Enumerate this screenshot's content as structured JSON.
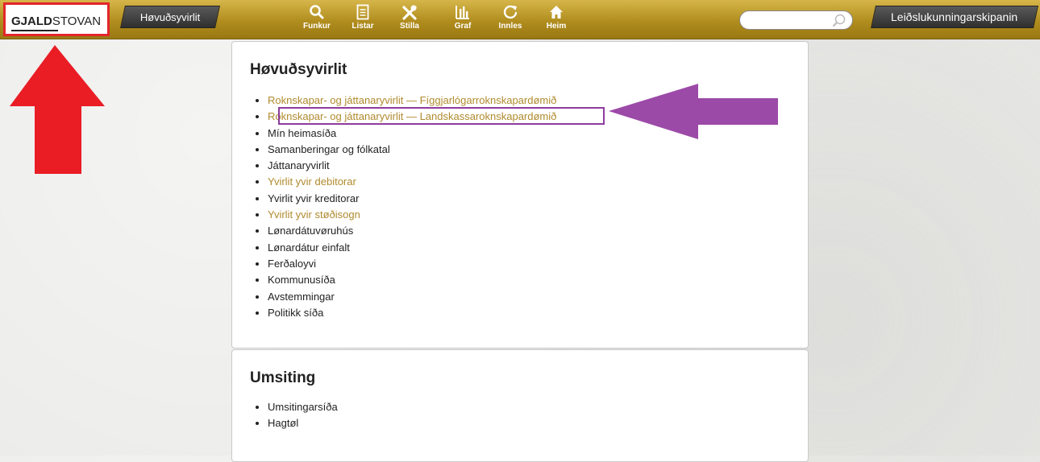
{
  "brand": {
    "bold": "GJALD",
    "light": "STOVAN"
  },
  "topbar": {
    "home_label": "Høvuðsyvirlit",
    "installation_label": "Leiðslukunningarskipanin",
    "nav": [
      {
        "label": "Funkur",
        "icon": "search-icon"
      },
      {
        "label": "Listar",
        "icon": "list-icon"
      },
      {
        "label": "Stilla",
        "icon": "tools-icon"
      },
      {
        "label": "Graf",
        "icon": "chart-icon"
      },
      {
        "label": "Innles",
        "icon": "refresh-icon"
      },
      {
        "label": "Heim",
        "icon": "home-icon"
      }
    ],
    "search": {
      "value": "",
      "placeholder": ""
    }
  },
  "overview": {
    "title": "Høvuðsyvirlit",
    "items": [
      {
        "label": "Roknskapar- og játtanaryvirlit — Fíggjarlógarroknskapardømið",
        "link": true
      },
      {
        "label": "Roknskapar- og játtanaryvirlit — Landskassaroknskapardømið",
        "link": true
      },
      {
        "label": "Mín heimasíða",
        "link": false
      },
      {
        "label": "Samanberingar og fólkatal",
        "link": false
      },
      {
        "label": "Játtanaryvirlit",
        "link": false
      },
      {
        "label": "Yvirlit yvir debitorar",
        "link": true
      },
      {
        "label": "Yvirlit yvir kreditorar",
        "link": false
      },
      {
        "label": "Yvirlit yvir støðisogn",
        "link": true
      },
      {
        "label": "Lønardátuvøruhús",
        "link": false
      },
      {
        "label": "Lønardátur einfalt",
        "link": false
      },
      {
        "label": "Ferðaloyvi",
        "link": false
      },
      {
        "label": "Kommunusíða",
        "link": false
      },
      {
        "label": "Avstemmingar",
        "link": false
      },
      {
        "label": "Politikk síða",
        "link": false
      }
    ]
  },
  "admin": {
    "title": "Umsiting",
    "items": [
      {
        "label": "Umsitingarsíða"
      },
      {
        "label": "Hagtøl"
      }
    ]
  },
  "colors": {
    "topbar_gold": "#b18d1e",
    "link_gold": "#b08b2f",
    "highlight_red": "#e3262b",
    "highlight_purple": "#9c4aa8"
  }
}
